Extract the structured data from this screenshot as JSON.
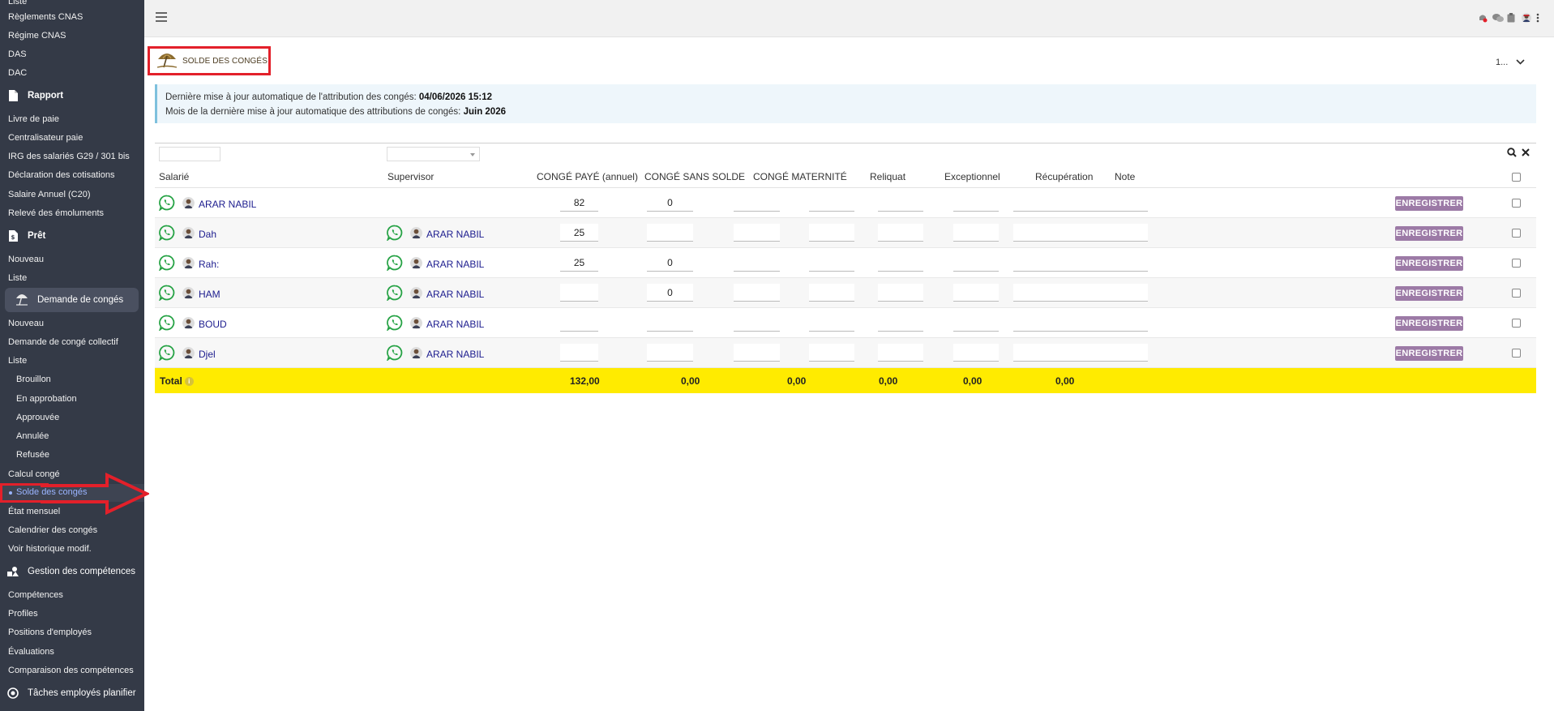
{
  "sidebar": {
    "items_top": [
      "Liste",
      "Règlements CNAS",
      "Régime CNAS",
      "DAS",
      "DAC"
    ],
    "rapport": {
      "label": "Rapport",
      "items": [
        "Livre de paie",
        "Centralisateur paie",
        "IRG des salariés G29 / 301 bis",
        "Déclaration des cotisations",
        "Salaire Annuel (C20)",
        "Relevé des émoluments"
      ]
    },
    "pret": {
      "label": "Prêt",
      "items": [
        "Nouveau",
        "Liste"
      ]
    },
    "conges": {
      "label": "Demande de congés",
      "items": [
        "Nouveau",
        "Demande de congé collectif",
        "Liste"
      ],
      "sub_items": [
        "Brouillon",
        "En approbation",
        "Approuvée",
        "Annulée",
        "Refusée"
      ],
      "items_after": [
        "Calcul congé"
      ],
      "current": "Solde des congés",
      "items_end": [
        "État mensuel",
        "Calendrier des congés",
        "Voir historique modif."
      ]
    },
    "competences": {
      "label": "Gestion des compétences",
      "items": [
        "Compétences",
        "Profiles",
        "Positions d'employés",
        "Évaluations",
        "Comparaison des compétences"
      ]
    },
    "taches": {
      "label": "Tâches employés planifier"
    }
  },
  "header": {
    "menu_icon": "hamburger-icon",
    "right_icons": [
      "notifications-icon",
      "chat-icon",
      "clipboard-icon",
      "user-avatar",
      "more-vertical-icon"
    ]
  },
  "page": {
    "title": "SOLDE DES CONGÉS",
    "pager_value": "1..."
  },
  "info": {
    "line1_label": "Dernière mise à jour automatique de l'attribution des congés:",
    "line1_value": "04/06/2026 15:12",
    "line2_label": "Mois de la dernière mise à jour automatique des attributions de congés:",
    "line2_value": "Juin 2026"
  },
  "table": {
    "columns": {
      "salarie": "Salarié",
      "supervisor": "Supervisor",
      "conge_paye": "CONGÉ PAYÉ (annuel)",
      "conge_sans_solde": "CONGÉ SANS SOLDE",
      "conge_maternite": "CONGÉ MATERNITÉ",
      "reliquat": "Reliquat",
      "exceptionnel": "Exceptionnel",
      "recuperation": "Récupération",
      "note": "Note"
    },
    "save_label": "ENREGISTRER",
    "rows": [
      {
        "name": "ARAR NABIL",
        "supervisor": "",
        "conge_paye": "82",
        "conge_sans_solde": "0",
        "conge_maternite": "",
        "reliquat": "",
        "exceptionnel": "",
        "recuperation": "",
        "note": ""
      },
      {
        "name": "Dah",
        "supervisor": "ARAR NABIL",
        "conge_paye": "25",
        "conge_sans_solde": "",
        "conge_maternite": "",
        "reliquat": "",
        "exceptionnel": "",
        "recuperation": "",
        "note": ""
      },
      {
        "name": "Rah:",
        "supervisor": "ARAR NABIL",
        "conge_paye": "25",
        "conge_sans_solde": "0",
        "conge_maternite": "",
        "reliquat": "",
        "exceptionnel": "",
        "recuperation": "",
        "note": ""
      },
      {
        "name": "HAM",
        "supervisor": "ARAR NABIL",
        "conge_paye": "",
        "conge_sans_solde": "0",
        "conge_maternite": "",
        "reliquat": "",
        "exceptionnel": "",
        "recuperation": "",
        "note": ""
      },
      {
        "name": "BOUD",
        "supervisor": "ARAR NABIL",
        "conge_paye": "",
        "conge_sans_solde": "",
        "conge_maternite": "",
        "reliquat": "",
        "exceptionnel": "",
        "recuperation": "",
        "note": ""
      },
      {
        "name": "Djel",
        "supervisor": "ARAR NABIL",
        "conge_paye": "",
        "conge_sans_solde": "",
        "conge_maternite": "",
        "reliquat": "",
        "exceptionnel": "",
        "recuperation": "",
        "note": ""
      }
    ],
    "total": {
      "label": "Total",
      "conge_paye": "132,00",
      "conge_sans_solde": "0,00",
      "conge_maternite": "0,00",
      "reliquat": "0,00",
      "exceptionnel": "0,00",
      "recuperation": "0,00"
    }
  },
  "colors": {
    "sidebar_bg": "#343a47",
    "highlight_red": "#e3202a",
    "save_button": "#9c7aa6",
    "total_row": "#ffeb00",
    "whatsapp": "#25a244"
  }
}
